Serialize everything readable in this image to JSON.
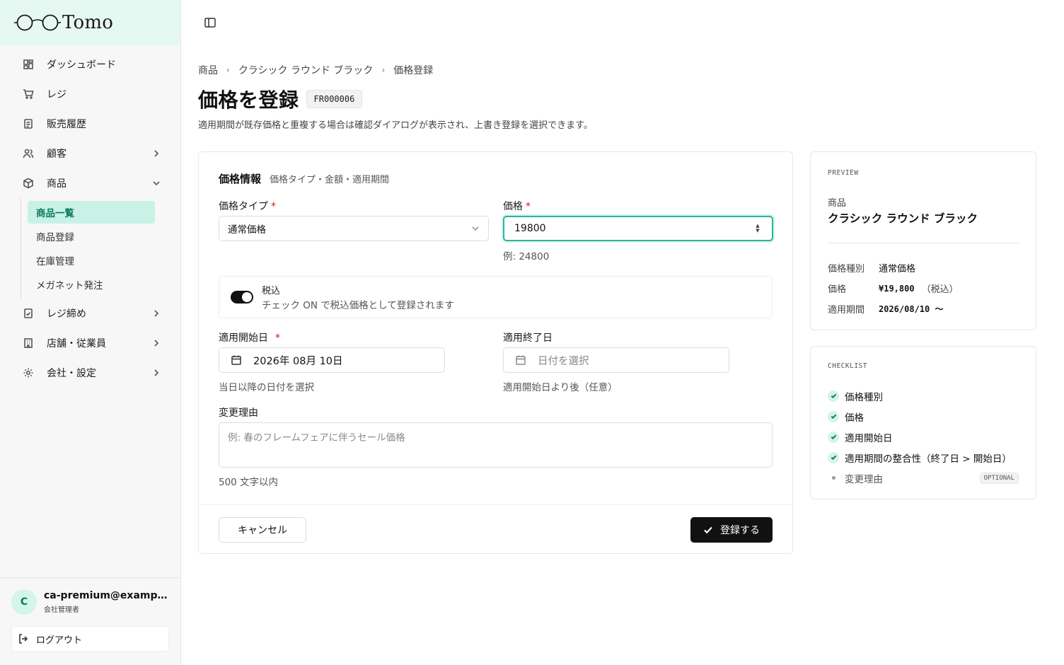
{
  "brand": {
    "name": "Tomo"
  },
  "sidebar": {
    "items": [
      {
        "label": "ダッシュボード",
        "icon": "dashboard-icon"
      },
      {
        "label": "レジ",
        "icon": "cart-icon"
      },
      {
        "label": "販売履歴",
        "icon": "receipt-icon"
      },
      {
        "label": "顧客",
        "icon": "users-icon"
      },
      {
        "label": "商品",
        "icon": "box-icon"
      },
      {
        "label": "レジ締め",
        "icon": "register-close-icon"
      },
      {
        "label": "店舗・従業員",
        "icon": "building-icon"
      },
      {
        "label": "会社・設定",
        "icon": "gear-icon"
      }
    ],
    "product_sub": [
      "商品一覧",
      "商品登録",
      "在庫管理",
      "メガネット発注"
    ]
  },
  "user": {
    "initial": "C",
    "email": "ca-premium@example.com",
    "role": "会社管理者",
    "logout_label": "ログアウト"
  },
  "breadcrumb": [
    "商品",
    "クラシック ラウンド ブラック",
    "価格登録"
  ],
  "page": {
    "title": "価格を登録",
    "code": "FR000006",
    "subtitle": "適用期間が既存価格と重複する場合は確認ダイアログが表示され、上書き登録を選択できます。"
  },
  "form": {
    "section_title": "価格情報",
    "section_sub": "価格タイプ・金額・適用期間",
    "price_type_label": "価格タイプ",
    "price_type_value": "通常価格",
    "price_label": "価格",
    "price_value": "19800",
    "price_helper": "例: 24800",
    "tax_title": "税込",
    "tax_desc": "チェック ON で税込価格として登録されます",
    "tax_on": true,
    "start_label": "適用開始日",
    "start_value": "2026年 08月 10日",
    "start_helper": "当日以降の日付を選択",
    "end_label": "適用終了日",
    "end_placeholder": "日付を選択",
    "end_helper": "適用開始日より後（任意）",
    "reason_label": "変更理由",
    "reason_placeholder": "例: 春のフレームフェアに伴うセール価格",
    "reason_helper": "500 文字以内",
    "required_mark": "*",
    "cancel_label": "キャンセル",
    "submit_label": "登録する"
  },
  "preview": {
    "kicker": "PREVIEW",
    "product_label": "商品",
    "product_name": "クラシック ラウンド ブラック",
    "type_key": "価格種別",
    "type_value": "通常価格",
    "price_key": "価格",
    "price_value": "¥19,800",
    "price_note": "（税込）",
    "period_key": "適用期間",
    "period_value": "2026/08/10 〜"
  },
  "checklist": {
    "kicker": "CHECKLIST",
    "items": [
      {
        "label": "価格種別",
        "done": true
      },
      {
        "label": "価格",
        "done": true
      },
      {
        "label": "適用開始日",
        "done": true
      },
      {
        "label": "適用期間の整合性（終了日 > 開始日）",
        "done": true
      },
      {
        "label": "変更理由",
        "done": false,
        "badge": "OPTIONAL"
      }
    ]
  },
  "colors": {
    "accent": "#2bb59a",
    "active_bg": "#c9f2e6",
    "brand_bg": "#e6f8f2"
  }
}
